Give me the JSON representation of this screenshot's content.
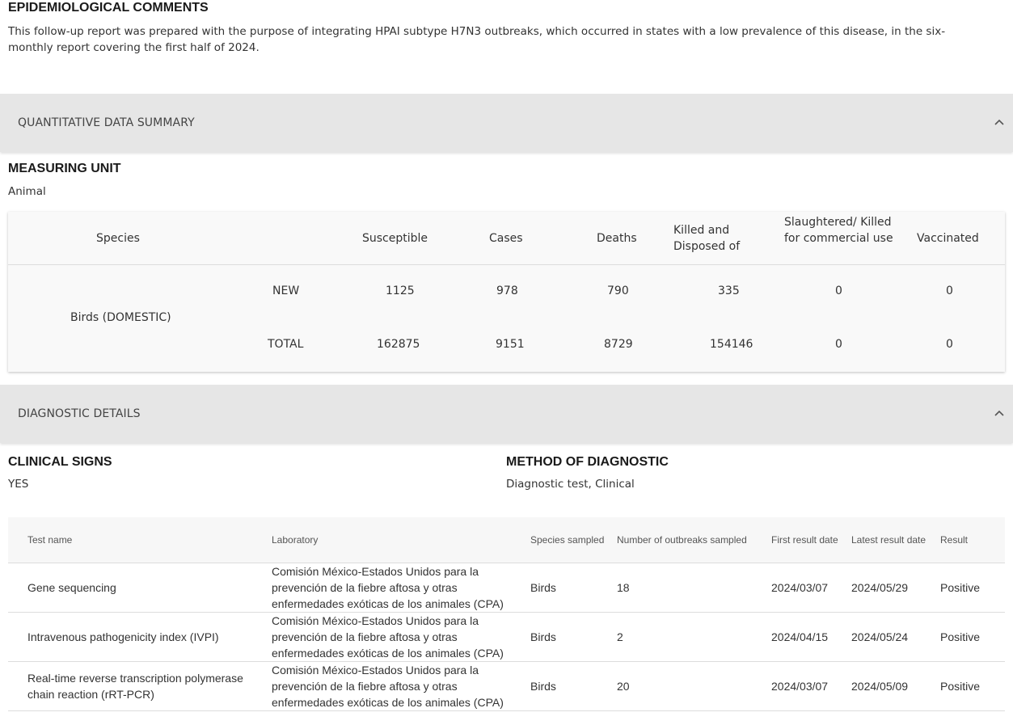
{
  "epi": {
    "title": "EPIDEMIOLOGICAL COMMENTS",
    "text": "This follow-up report was prepared with the purpose of integrating HPAI subtype H7N3 outbreaks, which occurred in states with a low prevalence of this disease, in the six-monthly report covering the first half of 2024."
  },
  "quant": {
    "section_label": "QUANTITATIVE DATA SUMMARY",
    "measuring_unit_title": "MEASURING UNIT",
    "measuring_unit_value": "Animal",
    "headers": {
      "species": "Species",
      "susceptible": "Susceptible",
      "cases": "Cases",
      "deaths": "Deaths",
      "killed": "Killed and Disposed of",
      "slaughtered": "Slaughtered/ Killed for commercial use",
      "vaccinated": "Vaccinated"
    },
    "species_name": "Birds (DOMESTIC)",
    "rows": [
      {
        "type": "NEW",
        "susceptible": "1125",
        "cases": "978",
        "deaths": "790",
        "killed": "335",
        "slaughtered": "0",
        "vaccinated": "0"
      },
      {
        "type": "TOTAL",
        "susceptible": "162875",
        "cases": "9151",
        "deaths": "8729",
        "killed": "154146",
        "slaughtered": "0",
        "vaccinated": "0"
      }
    ]
  },
  "diag": {
    "section_label": "DIAGNOSTIC DETAILS",
    "clinical_signs_title": "CLINICAL SIGNS",
    "clinical_signs_value": "YES",
    "method_title": "METHOD OF DIAGNOSTIC",
    "method_value": "Diagnostic test, Clinical",
    "table_headers": {
      "test_name": "Test name",
      "laboratory": "Laboratory",
      "species": "Species sampled",
      "outbreaks": "Number of outbreaks sampled",
      "first_date": "First result date",
      "latest_date": "Latest result date",
      "result": "Result"
    },
    "rows": [
      {
        "test_name": "Gene sequencing",
        "laboratory": "Comisión México-Estados Unidos para la prevención de la fiebre aftosa y otras enfermedades exóticas de los animales (CPA)",
        "species": "Birds",
        "outbreaks": "18",
        "first_date": "2024/03/07",
        "latest_date": "2024/05/29",
        "result": "Positive"
      },
      {
        "test_name": "Intravenous pathogenicity index (IVPI)",
        "laboratory": "Comisión México-Estados Unidos para la prevención de la fiebre aftosa y otras enfermedades exóticas de los animales (CPA)",
        "species": "Birds",
        "outbreaks": "2",
        "first_date": "2024/04/15",
        "latest_date": "2024/05/24",
        "result": "Positive"
      },
      {
        "test_name": "Real-time reverse transcription polymerase chain reaction (rRT-PCR)",
        "laboratory": "Comisión México-Estados Unidos para la prevención de la fiebre aftosa y otras enfermedades exóticas de los animales (CPA)",
        "species": "Birds",
        "outbreaks": "20",
        "first_date": "2024/03/07",
        "latest_date": "2024/05/09",
        "result": "Positive"
      }
    ]
  },
  "icons": {
    "collapse": "chevron-up-icon"
  },
  "colors": {
    "section_bg": "#e6e6e6",
    "card_bg": "#f9f9f9",
    "text": "#333333"
  }
}
